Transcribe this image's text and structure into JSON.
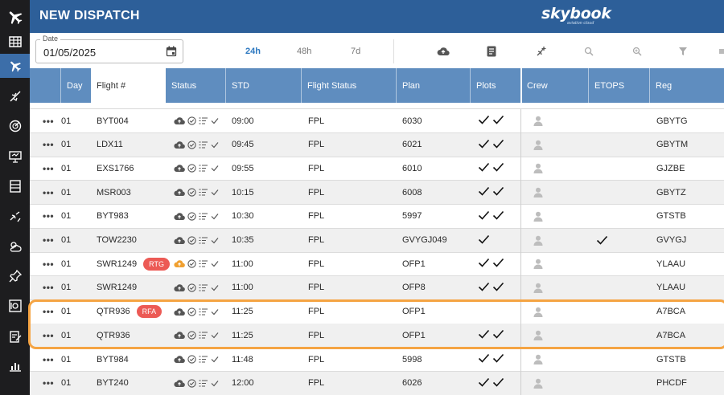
{
  "header": {
    "title": "NEW DISPATCH",
    "brand": "skybook",
    "brand_sub": "aviation cloud"
  },
  "nav": {
    "items": [
      {
        "name": "flight-plan-icon"
      },
      {
        "name": "dispatch-icon",
        "active": true
      },
      {
        "name": "no-fly-icon"
      },
      {
        "name": "radar-icon"
      },
      {
        "name": "presentation-icon"
      },
      {
        "name": "list-icon"
      },
      {
        "name": "routes-icon"
      },
      {
        "name": "weather-icon"
      },
      {
        "name": "pin-icon"
      },
      {
        "name": "safe-icon"
      },
      {
        "name": "report-icon"
      },
      {
        "name": "chart-icon"
      }
    ]
  },
  "toolbar": {
    "date_label": "Date",
    "date_value": "01/05/2025",
    "ranges": [
      "24h",
      "48h",
      "7d"
    ],
    "active_range": "24h"
  },
  "table": {
    "columns": [
      "Day",
      "Flight #",
      "Status",
      "STD",
      "Flight Status",
      "Plan",
      "Plots",
      "Crew",
      "ETOPS",
      "Reg"
    ],
    "rows": [
      {
        "day": "01",
        "flight": "BYT004",
        "badge": "",
        "std": "09:00",
        "fstatus": "FPL",
        "plan": "6030",
        "plots": 2,
        "etops": false,
        "reg": "GBYTG",
        "cloud_orange": false
      },
      {
        "day": "01",
        "flight": "LDX11",
        "badge": "",
        "std": "09:45",
        "fstatus": "FPL",
        "plan": "6021",
        "plots": 2,
        "etops": false,
        "reg": "GBYTM",
        "cloud_orange": false
      },
      {
        "day": "01",
        "flight": "EXS1766",
        "badge": "",
        "std": "09:55",
        "fstatus": "FPL",
        "plan": "6010",
        "plots": 2,
        "etops": false,
        "reg": "GJZBE",
        "cloud_orange": false
      },
      {
        "day": "01",
        "flight": "MSR003",
        "badge": "",
        "std": "10:15",
        "fstatus": "FPL",
        "plan": "6008",
        "plots": 2,
        "etops": false,
        "reg": "GBYTZ",
        "cloud_orange": false
      },
      {
        "day": "01",
        "flight": "BYT983",
        "badge": "",
        "std": "10:30",
        "fstatus": "FPL",
        "plan": "5997",
        "plots": 2,
        "etops": false,
        "reg": "GTSTB",
        "cloud_orange": false
      },
      {
        "day": "01",
        "flight": "TOW2230",
        "badge": "",
        "std": "10:35",
        "fstatus": "FPL",
        "plan": "GVYGJ049",
        "plots": 1,
        "etops": true,
        "reg": "GVYGJ",
        "cloud_orange": false
      },
      {
        "day": "01",
        "flight": "SWR1249",
        "badge": "RTG",
        "std": "11:00",
        "fstatus": "FPL",
        "plan": "OFP1",
        "plots": 2,
        "etops": false,
        "reg": "YLAAU",
        "cloud_orange": true
      },
      {
        "day": "01",
        "flight": "SWR1249",
        "badge": "",
        "std": "11:00",
        "fstatus": "FPL",
        "plan": "OFP8",
        "plots": 2,
        "etops": false,
        "reg": "YLAAU",
        "cloud_orange": false
      },
      {
        "day": "01",
        "flight": "QTR936",
        "badge": "RFA",
        "std": "11:25",
        "fstatus": "FPL",
        "plan": "OFP1",
        "plots": 0,
        "etops": false,
        "reg": "A7BCA",
        "cloud_orange": false
      },
      {
        "day": "01",
        "flight": "QTR936",
        "badge": "",
        "std": "11:25",
        "fstatus": "FPL",
        "plan": "OFP1",
        "plots": 2,
        "etops": false,
        "reg": "A7BCA",
        "cloud_orange": false
      },
      {
        "day": "01",
        "flight": "BYT984",
        "badge": "",
        "std": "11:48",
        "fstatus": "FPL",
        "plan": "5998",
        "plots": 2,
        "etops": false,
        "reg": "GTSTB",
        "cloud_orange": false
      },
      {
        "day": "01",
        "flight": "BYT240",
        "badge": "",
        "std": "12:00",
        "fstatus": "FPL",
        "plan": "6026",
        "plots": 2,
        "etops": false,
        "reg": "PHCDF",
        "cloud_orange": false
      }
    ]
  },
  "colors": {
    "header": "#2d5f99",
    "table_header": "#5f8dbf",
    "highlight": "#f5a443",
    "badge": "#ec5a55",
    "nav": "#1d1d1f"
  }
}
